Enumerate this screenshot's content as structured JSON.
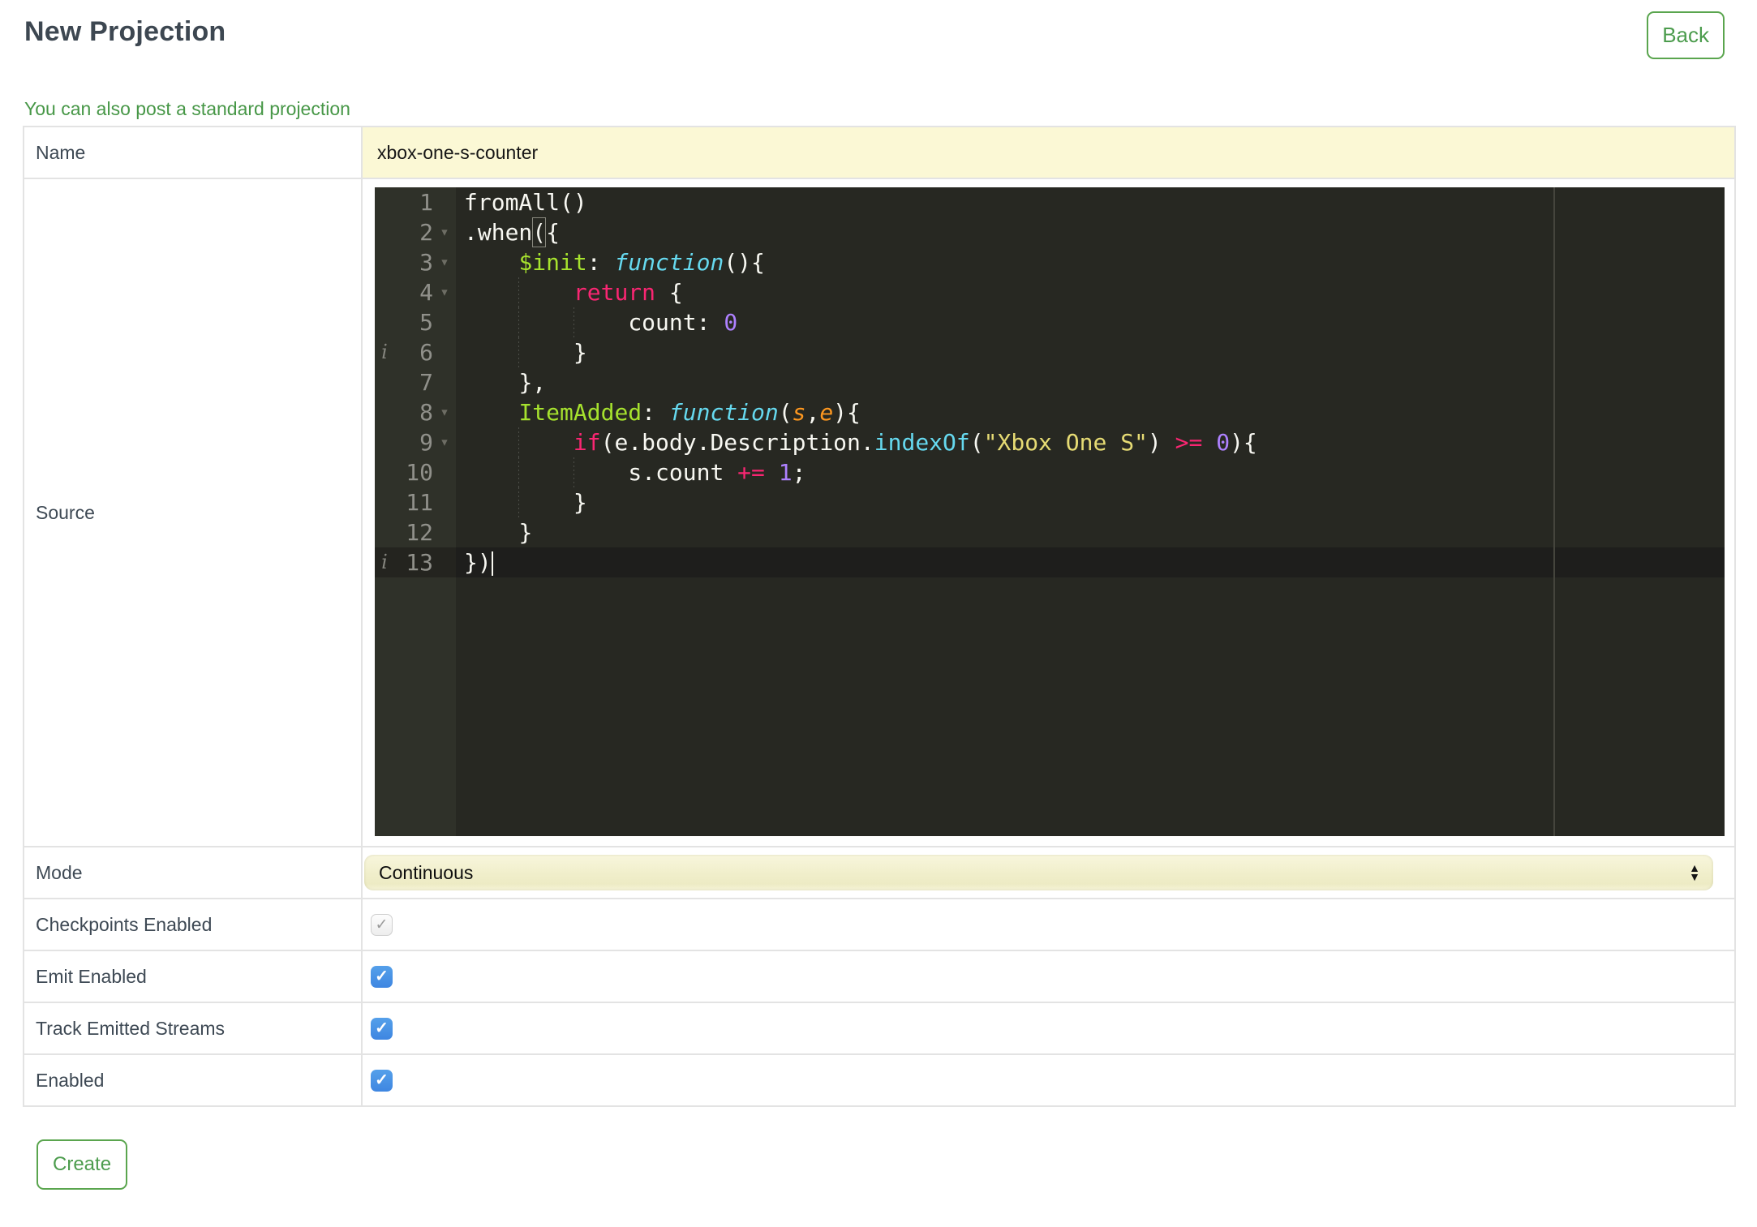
{
  "header": {
    "title": "New Projection",
    "back_label": "Back",
    "link_text": "You can also post a standard projection"
  },
  "form": {
    "name": {
      "label": "Name",
      "value": "xbox-one-s-counter"
    },
    "source": {
      "label": "Source"
    },
    "mode": {
      "label": "Mode",
      "value": "Continuous"
    },
    "checkpoints": {
      "label": "Checkpoints Enabled",
      "checked": true,
      "disabled": true
    },
    "emit": {
      "label": "Emit Enabled",
      "checked": true,
      "disabled": false
    },
    "track": {
      "label": "Track Emitted Streams",
      "checked": true,
      "disabled": false
    },
    "enabled": {
      "label": "Enabled",
      "checked": true,
      "disabled": false
    }
  },
  "footer": {
    "create_label": "Create"
  },
  "icons": {
    "check": "✓",
    "fold_arrow": "▾",
    "annotation_info": "i",
    "select_up": "▲",
    "select_down": "▼"
  },
  "colors": {
    "accent_green": "#4c9c4d",
    "green_border": "#5aa54e",
    "heading_text": "#3d4751",
    "label_text": "#3e4954",
    "input_yellow": "#fbf8d5",
    "checkbox_blue": "#4a90e2",
    "table_border": "#e3e3e3",
    "editor_background": "#272822",
    "editor_gutter": "#2f3129",
    "editor_active_line": "#1e1e1c",
    "syntax_keyword": "#f92672",
    "syntax_entity": "#a6e22e",
    "syntax_function": "#66d9ef",
    "syntax_param": "#fd971f",
    "syntax_string": "#e6db74",
    "syntax_number": "#ae81ff"
  },
  "editor": {
    "language": "javascript",
    "lines": [
      {
        "num": 1,
        "indent": 0,
        "segs": [
          [
            "p",
            "fromAll()"
          ]
        ]
      },
      {
        "num": 2,
        "indent": 0,
        "fold": true,
        "segs": [
          [
            "p",
            ".when"
          ],
          [
            "bx",
            "("
          ],
          [
            "p",
            "{"
          ]
        ]
      },
      {
        "num": 3,
        "indent": 4,
        "fold": true,
        "segs": [
          [
            "g",
            "$init"
          ],
          [
            "p",
            ": "
          ],
          [
            "f",
            "function"
          ],
          [
            "p",
            "(){"
          ]
        ]
      },
      {
        "num": 4,
        "indent": 8,
        "fold": true,
        "segs": [
          [
            "k",
            "return"
          ],
          [
            "p",
            " {"
          ]
        ]
      },
      {
        "num": 5,
        "indent": 12,
        "segs": [
          [
            "p",
            "count: "
          ],
          [
            "n",
            "0"
          ]
        ]
      },
      {
        "num": 6,
        "indent": 8,
        "annot": true,
        "segs": [
          [
            "p",
            "}"
          ]
        ]
      },
      {
        "num": 7,
        "indent": 4,
        "segs": [
          [
            "p",
            "},"
          ]
        ]
      },
      {
        "num": 8,
        "indent": 4,
        "fold": true,
        "segs": [
          [
            "g",
            "ItemAdded"
          ],
          [
            "p",
            ": "
          ],
          [
            "f",
            "function"
          ],
          [
            "p",
            "("
          ],
          [
            "o",
            "s"
          ],
          [
            "p",
            ","
          ],
          [
            "o",
            "e"
          ],
          [
            "p",
            "){"
          ]
        ]
      },
      {
        "num": 9,
        "indent": 8,
        "fold": true,
        "segs": [
          [
            "k",
            "if"
          ],
          [
            "p",
            "(e.body.Description."
          ],
          [
            "c",
            "indexOf"
          ],
          [
            "p",
            "("
          ],
          [
            "s",
            "\"Xbox One S\""
          ],
          [
            "p",
            ") "
          ],
          [
            "k",
            ">="
          ],
          [
            "p",
            " "
          ],
          [
            "n",
            "0"
          ],
          [
            "p",
            "){"
          ]
        ]
      },
      {
        "num": 10,
        "indent": 12,
        "segs": [
          [
            "p",
            "s.count "
          ],
          [
            "k",
            "+="
          ],
          [
            "p",
            " "
          ],
          [
            "n",
            "1"
          ],
          [
            "p",
            ";"
          ]
        ]
      },
      {
        "num": 11,
        "indent": 8,
        "segs": [
          [
            "p",
            "}"
          ]
        ]
      },
      {
        "num": 12,
        "indent": 4,
        "segs": [
          [
            "p",
            "}"
          ]
        ]
      },
      {
        "num": 13,
        "indent": 0,
        "annot": true,
        "active": true,
        "cursor": true,
        "segs": [
          [
            "p",
            "})"
          ]
        ]
      }
    ]
  }
}
